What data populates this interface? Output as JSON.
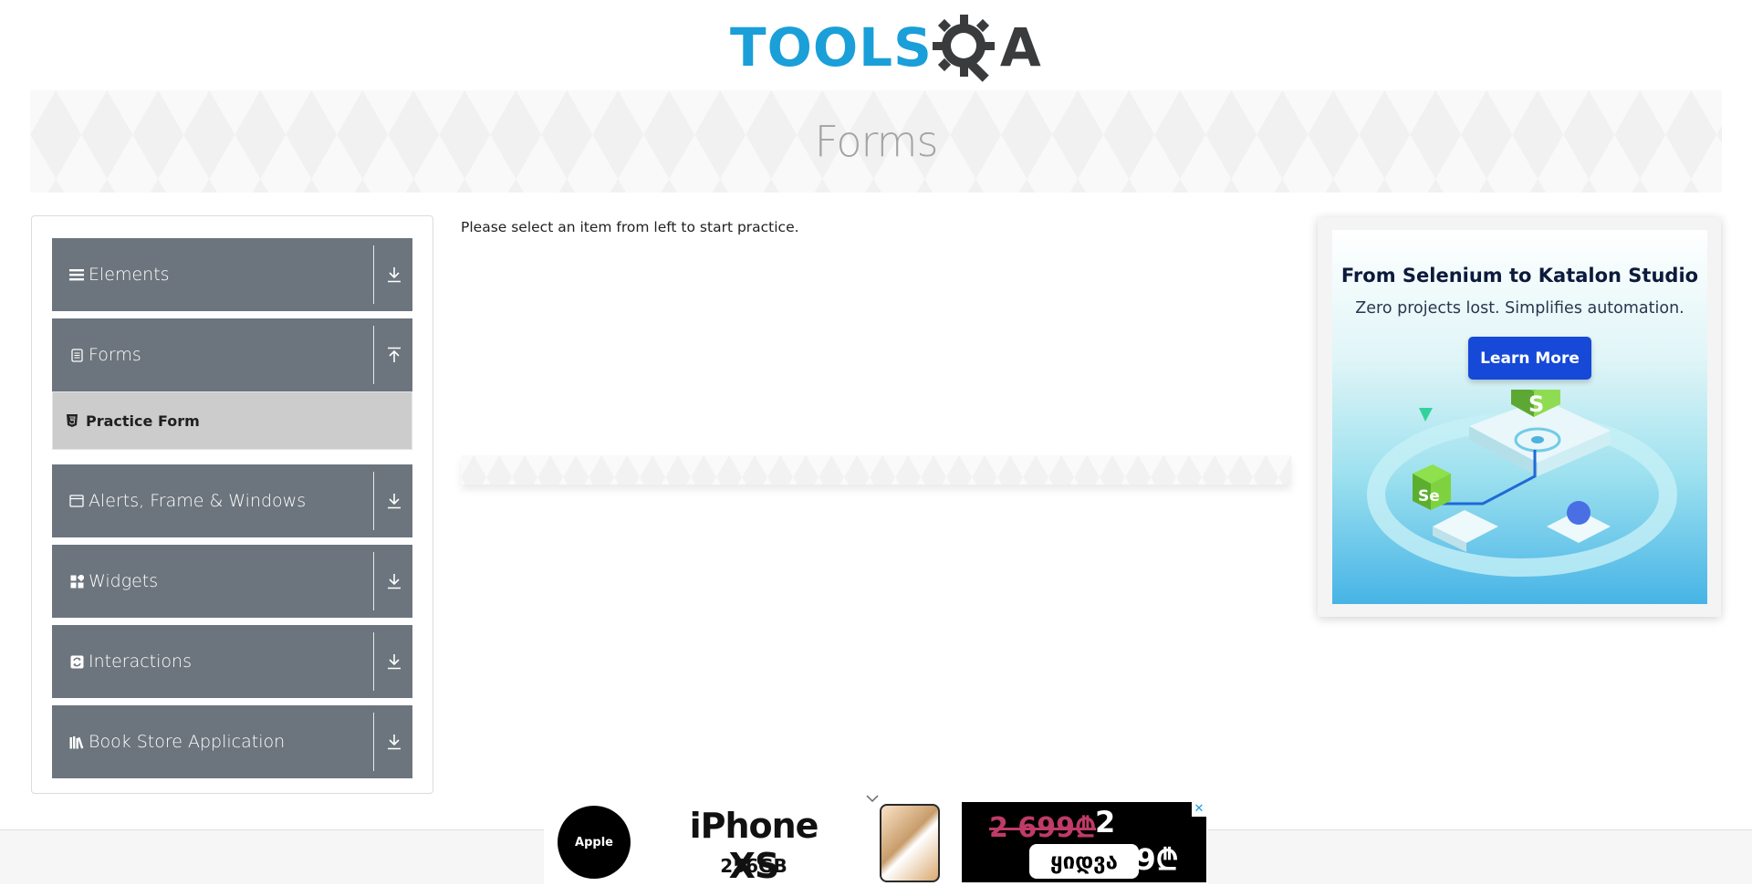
{
  "header": {
    "logo_tools": "TOOLS",
    "logo_qa": "A"
  },
  "banner": {
    "title": "Forms"
  },
  "sidebar": {
    "groups": [
      {
        "label": "Elements",
        "icon": "menu-icon",
        "state": "collapsed"
      },
      {
        "label": "Forms",
        "icon": "document-icon",
        "state": "expanded",
        "items": [
          {
            "label": "Practice Form",
            "icon": "html5-icon",
            "active": true
          }
        ]
      },
      {
        "label": "Alerts, Frame & Windows",
        "icon": "window-icon",
        "state": "collapsed"
      },
      {
        "label": "Widgets",
        "icon": "widgets-icon",
        "state": "collapsed"
      },
      {
        "label": "Interactions",
        "icon": "interactions-icon",
        "state": "collapsed"
      },
      {
        "label": "Book Store Application",
        "icon": "books-icon",
        "state": "collapsed"
      }
    ]
  },
  "main": {
    "instruction": "Please select an item from left to start practice."
  },
  "right_ad": {
    "title": "From Selenium to Katalon Studio",
    "subtitle": "Zero projects lost. Simplifies automation.",
    "button_label": "Learn More",
    "badge_s": "S",
    "badge_se": "Se"
  },
  "bottom_ad": {
    "brand": "Apple",
    "product": "iPhone XS",
    "storage": "256GB",
    "old_price": "2 699₾",
    "new_price": "2 499₾",
    "buy_label": "ყიდვა",
    "adchoice": "✕"
  },
  "colors": {
    "sidebar_header_bg": "#6c757d",
    "active_item_bg": "#cccccc",
    "logo_blue": "#1a9fd8",
    "logo_dark": "#3a3b3c",
    "ad_button": "#1649d8"
  }
}
